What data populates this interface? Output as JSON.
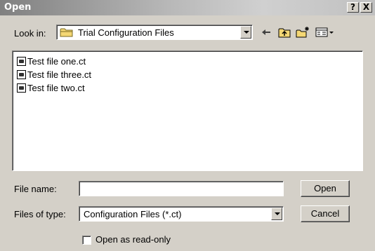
{
  "window": {
    "title": "Open",
    "help_glyph": "?",
    "close_glyph": "X"
  },
  "look_in": {
    "label": "Look in:",
    "value": "Trial Configuration Files",
    "icon": "folder-icon"
  },
  "toolbar": {
    "icons": [
      "back-arrow-icon",
      "up-folder-icon",
      "new-folder-icon",
      "view-menu-icon"
    ]
  },
  "files": [
    {
      "name": "Test file one.ct",
      "icon": "config-file-icon"
    },
    {
      "name": "Test file three.ct",
      "icon": "config-file-icon"
    },
    {
      "name": "Test file two.ct",
      "icon": "config-file-icon"
    }
  ],
  "file_name": {
    "label": "File name:",
    "value": ""
  },
  "files_of_type": {
    "label": "Files of type:",
    "value": "Configuration Files (*.ct)"
  },
  "buttons": {
    "open": "Open",
    "cancel": "Cancel"
  },
  "read_only": {
    "label": "Open as read-only",
    "checked": false
  },
  "colors": {
    "dialog_face": "#d4d0c8",
    "title_gradient_start": "#808080",
    "title_gradient_end": "#c0c0c0",
    "folder_yellow": "#f4d774"
  }
}
